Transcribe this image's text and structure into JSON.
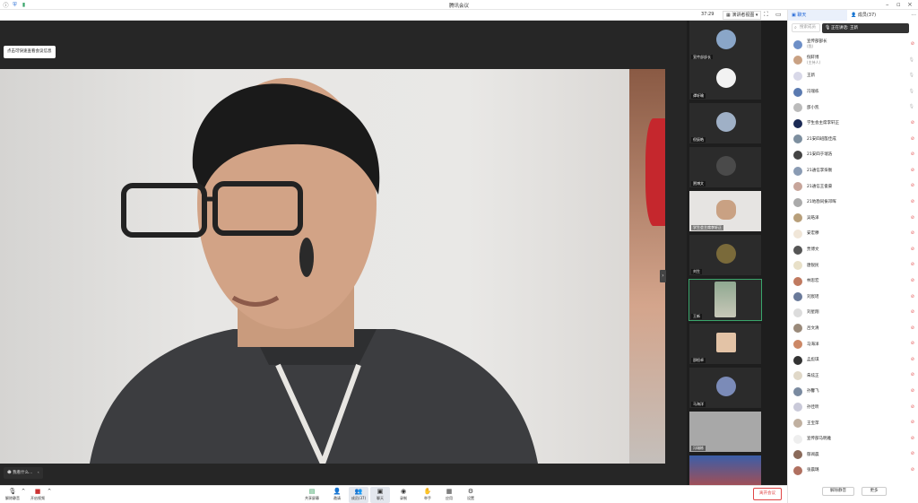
{
  "window": {
    "title": "腾讯会议"
  },
  "top_bar": {
    "time": "37:29",
    "view_mode": "演讲者视图"
  },
  "toast": {
    "text": "点击可快速查看会议信息"
  },
  "speaker_chip": {
    "label": "我看什么..."
  },
  "thumbnails": [
    {
      "name": "宣传部部长"
    },
    {
      "name": "谭轩瑜"
    },
    {
      "name": "倪辰皓"
    },
    {
      "name": "贾博文"
    },
    {
      "name": "学生会主席李轩正"
    },
    {
      "name": "刘生"
    },
    {
      "name": "王新"
    },
    {
      "name": "邵桓卓"
    },
    {
      "name": "马海洋"
    },
    {
      "name": "冯瑞栋"
    },
    {
      "name": ""
    }
  ],
  "panel": {
    "tabs": [
      {
        "label": "聊天"
      },
      {
        "label": "成员(37)"
      }
    ],
    "more": "···",
    "search_placeholder": "搜索成员",
    "speaking": "正在讲话: 王新",
    "members": [
      {
        "name": "宣传部部长",
        "sub": "(我)",
        "muted": true
      },
      {
        "name": "倪轩博",
        "sub": "(主持人)",
        "muted": false
      },
      {
        "name": "王新",
        "sub": "",
        "muted": false
      },
      {
        "name": "冯瑞栋",
        "sub": "",
        "muted": false
      },
      {
        "name": "邵小凯",
        "sub": "",
        "muted": false
      },
      {
        "name": "学生会主席李轩正",
        "sub": "",
        "muted": true
      },
      {
        "name": "21安四班殷佳成",
        "sub": "",
        "muted": true
      },
      {
        "name": "21安四于瑞浩",
        "sub": "",
        "muted": true
      },
      {
        "name": "21通信李柒衡",
        "sub": "",
        "muted": true
      },
      {
        "name": "21通信王俊豪",
        "sub": "",
        "muted": true
      },
      {
        "name": "21地勘同振邓晖",
        "sub": "",
        "muted": true
      },
      {
        "name": "吴皓泽",
        "sub": "",
        "muted": true
      },
      {
        "name": "安宏穆",
        "sub": "",
        "muted": true
      },
      {
        "name": "贾博文",
        "sub": "",
        "muted": true
      },
      {
        "name": "唐锐民",
        "sub": "",
        "muted": true
      },
      {
        "name": "林思宏",
        "sub": "",
        "muted": true
      },
      {
        "name": "刘宸瑶",
        "sub": "",
        "muted": true
      },
      {
        "name": "刘星翔",
        "sub": "",
        "muted": true
      },
      {
        "name": "吕文清",
        "sub": "",
        "muted": true
      },
      {
        "name": "马海洋",
        "sub": "",
        "muted": true
      },
      {
        "name": "孟彪琪",
        "sub": "",
        "muted": true
      },
      {
        "name": "朱炫正",
        "sub": "",
        "muted": true
      },
      {
        "name": "孙馨飞",
        "sub": "",
        "muted": true
      },
      {
        "name": "孙佳昕",
        "sub": "",
        "muted": true
      },
      {
        "name": "王宝萍",
        "sub": "",
        "muted": true
      },
      {
        "name": "宣传部马明雅",
        "sub": "",
        "muted": true
      },
      {
        "name": "郁阅晨",
        "sub": "",
        "muted": true
      },
      {
        "name": "张晨璐",
        "sub": "",
        "muted": true
      }
    ],
    "mute_all": "解除静音",
    "more_btn": "更多"
  },
  "toolbar": {
    "left": [
      {
        "icon": "mic-icon",
        "label": "解除静音"
      },
      {
        "icon": "camera-icon",
        "label": "开启视频"
      }
    ],
    "center": [
      {
        "icon": "share-screen-icon",
        "label": "共享屏幕"
      },
      {
        "icon": "invite-icon",
        "label": "邀请"
      },
      {
        "icon": "members-icon",
        "label": "成员(37)"
      },
      {
        "icon": "chat-icon",
        "label": "聊天"
      },
      {
        "icon": "record-icon",
        "label": "录制"
      },
      {
        "icon": "raise-hand-icon",
        "label": "举手"
      },
      {
        "icon": "apps-icon",
        "label": "应用"
      },
      {
        "icon": "settings-icon",
        "label": "设置"
      }
    ],
    "end_meeting": "离开会议"
  }
}
